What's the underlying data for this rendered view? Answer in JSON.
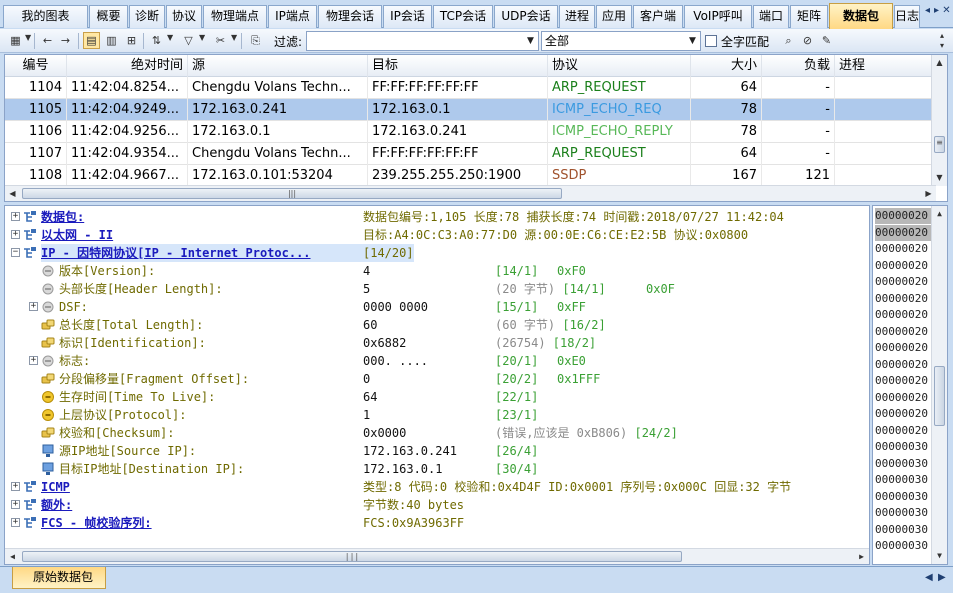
{
  "tabs": [
    "我的图表",
    "概要",
    "诊断",
    "协议",
    "物理端点",
    "IP端点",
    "物理会话",
    "IP会话",
    "TCP会话",
    "UDP会话",
    "进程",
    "应用",
    "客户端",
    "VoIP呼叫",
    "端口",
    "矩阵",
    "数据包",
    "日志"
  ],
  "active_tab": "数据包",
  "toolbar": {
    "filter_label": "过滤:",
    "filter_value": "",
    "scope_value": "全部",
    "match_whole_label": "全字匹配"
  },
  "packet_list": {
    "columns": [
      "编号",
      "绝对时间",
      "源",
      "目标",
      "协议",
      "大小",
      "负载",
      "进程"
    ],
    "rows": [
      {
        "no": "1104",
        "time": "11:42:04.8254...",
        "src": "Chengdu Volans Techn...",
        "dst": "FF:FF:FF:FF:FF:FF",
        "proto": "ARP_REQUEST",
        "size": "64",
        "payload": "-",
        "process": "",
        "color": "#1a7f1a"
      },
      {
        "no": "1105",
        "time": "11:42:04.9249...",
        "src": "172.163.0.241",
        "dst": "172.163.0.1",
        "proto": "ICMP_ECHO_REQ",
        "size": "78",
        "payload": "-",
        "process": "",
        "color": "#3a9ae0"
      },
      {
        "no": "1106",
        "time": "11:42:04.9256...",
        "src": "172.163.0.1",
        "dst": "172.163.0.241",
        "proto": "ICMP_ECHO_REPLY",
        "size": "78",
        "payload": "-",
        "process": "",
        "color": "#58b858"
      },
      {
        "no": "1107",
        "time": "11:42:04.9354...",
        "src": "Chengdu Volans Techn...",
        "dst": "FF:FF:FF:FF:FF:FF",
        "proto": "ARP_REQUEST",
        "size": "64",
        "payload": "-",
        "process": "",
        "color": "#1a7f1a"
      },
      {
        "no": "1108",
        "time": "11:42:04.9667...",
        "src": "172.163.0.101:53204",
        "dst": "239.255.255.250:1900",
        "proto": "SSDP",
        "size": "167",
        "payload": "121",
        "process": "",
        "color": "#a0522d"
      }
    ]
  },
  "decode_tree": [
    {
      "name": "数据包:",
      "value": "数据包编号:1,105 长度:78 捕获长度:74 时间戳:2018/07/27 11:42:04",
      "extra1": "",
      "extra2": ""
    },
    {
      "name": "以太网 - II",
      "value": "目标:A4:0C:C3:A0:77:D0 源:00:0E:C6:CE:E2:5B 协议:0x0800",
      "extra1": "",
      "extra2": ""
    },
    {
      "name": "IP - 因特网协议[IP - Internet Protoc...",
      "value": "",
      "extra1": "[14/20]",
      "extra2": ""
    },
    {
      "name": "版本[Version]:",
      "value": "4",
      "extra1": "[14/1]",
      "extra2": "0xF0"
    },
    {
      "name": "头部长度[Header Length]:",
      "value": "5",
      "extra1": "(20 字节)   [14/1]",
      "extra2": "0x0F"
    },
    {
      "name": "DSF:",
      "value": "0000 0000",
      "extra1": "[15/1]",
      "extra2": "0xFF"
    },
    {
      "name": "总长度[Total Length]:",
      "value": "60",
      "extra1": "(60 字节)   [16/2]",
      "extra2": ""
    },
    {
      "name": "标识[Identification]:",
      "value": "0x6882",
      "extra1": "(26754)   [18/2]",
      "extra2": ""
    },
    {
      "name": "标志:",
      "value": "000. ....",
      "extra1": "[20/1]",
      "extra2": "0xE0"
    },
    {
      "name": "分段偏移量[Fragment Offset]:",
      "value": "0",
      "extra1": "[20/2]",
      "extra2": "0x1FFF"
    },
    {
      "name": "生存时间[Time To Live]:",
      "value": "64",
      "extra1": "[22/1]",
      "extra2": ""
    },
    {
      "name": "上层协议[Protocol]:",
      "value": "1",
      "extra1": "[23/1]",
      "extra2": ""
    },
    {
      "name": "校验和[Checksum]:",
      "value": "0x0000",
      "extra1": "(错误,应该是 0xB806)   [24/2]",
      "extra2": ""
    },
    {
      "name": "源IP地址[Source IP]:",
      "value": "172.163.0.241",
      "extra1": "[26/4]",
      "extra2": ""
    },
    {
      "name": "目标IP地址[Destination IP]:",
      "value": "172.163.0.1",
      "extra1": "[30/4]",
      "extra2": ""
    },
    {
      "name": "ICMP",
      "value": "类型:8 代码:0 校验和:0x4D4F ID:0x0001 序列号:0x000C 回显:32 字节",
      "extra1": "",
      "extra2": ""
    },
    {
      "name": "额外:",
      "value": "字节数:40 bytes",
      "extra1": "",
      "extra2": ""
    },
    {
      "name": "FCS - 帧校验序列:",
      "value": "FCS:0x9A3963FF",
      "extra1": "",
      "extra2": ""
    }
  ],
  "hex_offsets": [
    "00000020",
    "00000020",
    "00000020",
    "00000020",
    "00000020",
    "00000020",
    "00000020",
    "00000020",
    "00000020",
    "00000020",
    "00000020",
    "00000020",
    "00000020",
    "00000020",
    "00000030",
    "00000030",
    "00000030",
    "00000030",
    "00000030",
    "00000030",
    "00000030"
  ],
  "bottom_tab": "原始数据包",
  "colors": {
    "accent": "#ffd884",
    "selection": "#aec9ec",
    "frame": "#c9dcf2"
  }
}
